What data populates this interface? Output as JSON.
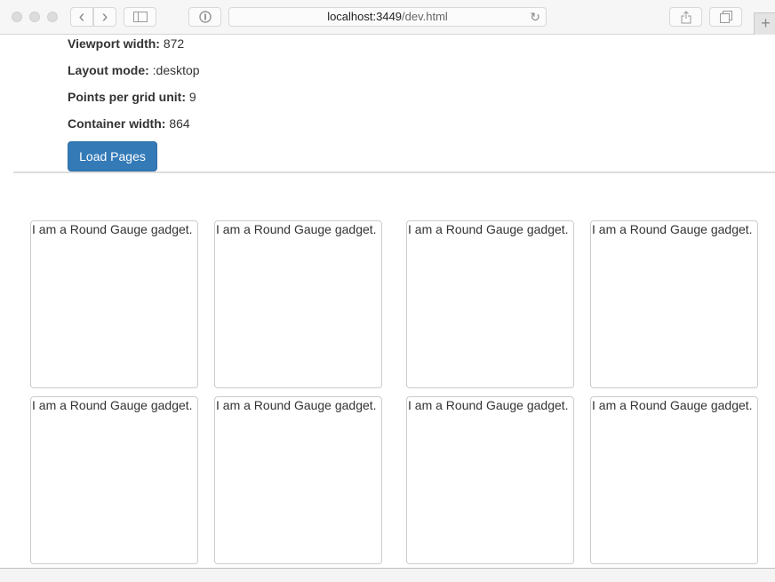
{
  "browser": {
    "url_host": "localhost:3449",
    "url_path": "/dev.html",
    "icons": {
      "back": "‹",
      "forward": "›",
      "reload": "↻",
      "new_tab": "+"
    }
  },
  "info": {
    "viewport_label": "Viewport width:",
    "viewport_value": " 872",
    "layout_label": "Layout mode:",
    "layout_value": " :desktop",
    "points_label": "Points per grid unit:",
    "points_value": " 9",
    "container_label": "Container width:",
    "container_value": " 864"
  },
  "load_button": "Load Pages",
  "gadgets": [
    "I am a Round Gauge gadget.",
    "I am a Round Gauge gadget.",
    "I am a Round Gauge gadget.",
    "I am a Round Gauge gadget.",
    "I am a Round Gauge gadget.",
    "I am a Round Gauge gadget.",
    "I am a Round Gauge gadget.",
    "I am a Round Gauge gadget."
  ]
}
